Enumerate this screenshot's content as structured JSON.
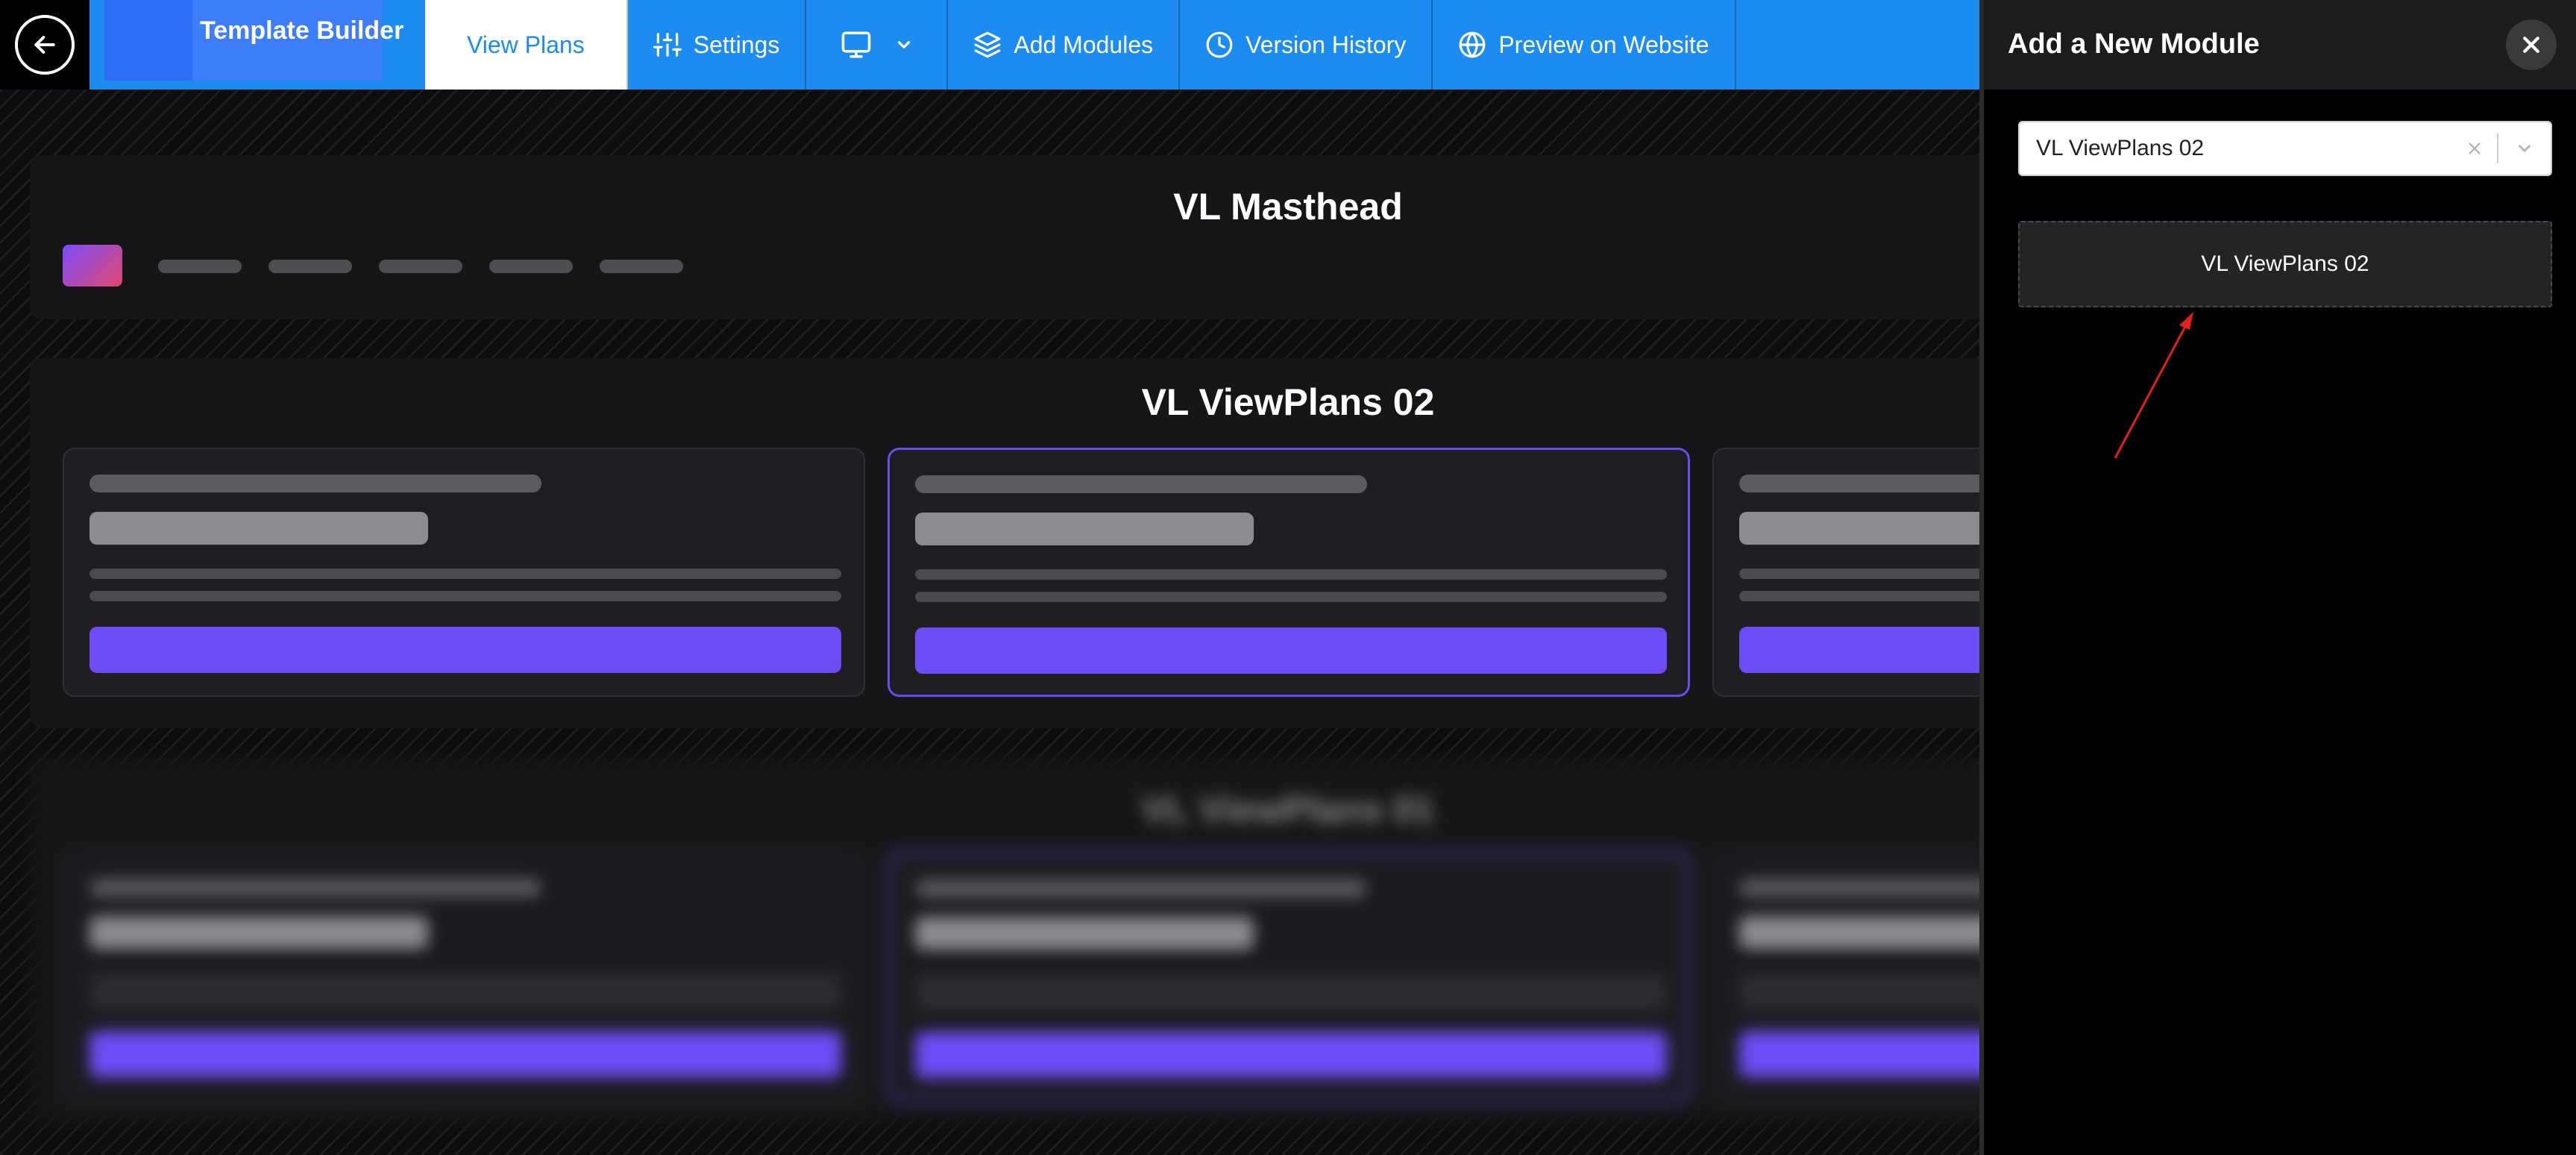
{
  "topbar": {
    "brand_title": "Template Builder",
    "nav": {
      "view_plans": "View Plans",
      "settings": "Settings",
      "add_modules": "Add Modules",
      "version_history": "Version History",
      "preview": "Preview on Website"
    }
  },
  "canvas": {
    "masthead_title": "VL Masthead",
    "viewplans_title": "VL ViewPlans 02",
    "blurred_title": "VL ViewPlans 01"
  },
  "panel": {
    "title": "Add a New Module",
    "select": {
      "value": "VL ViewPlans 02"
    },
    "option_label": "VL ViewPlans 02"
  },
  "colors": {
    "nav_blue": "#1d8cf0",
    "accent_purple": "#6e4cf5",
    "annotation_red": "#e0211b"
  }
}
